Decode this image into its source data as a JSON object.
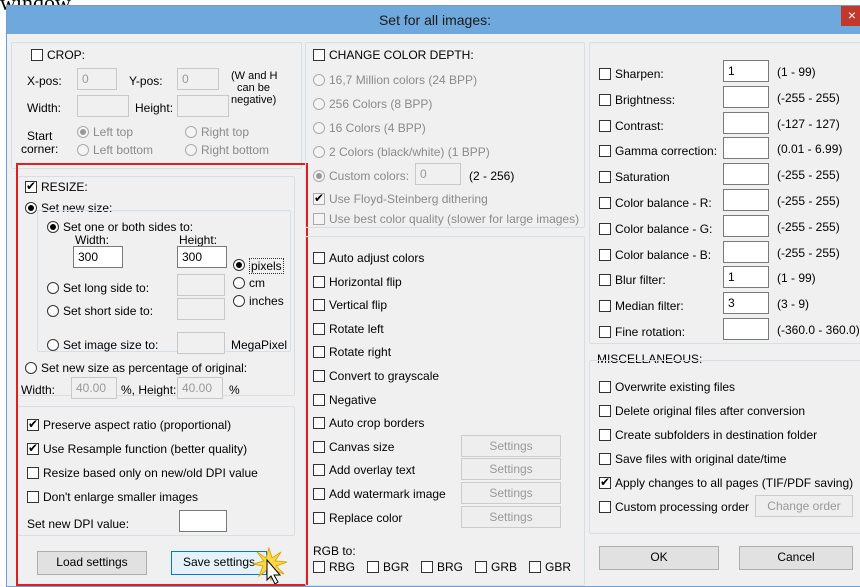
{
  "caption": "window.",
  "dialog": {
    "title": "Set for all images:",
    "close": "×"
  },
  "crop": {
    "label": "CROP:",
    "xpos_label": "X-pos:",
    "xpos": "0",
    "ypos_label": "Y-pos:",
    "ypos": "0",
    "note": [
      "(W and H",
      "can be",
      "negative)"
    ],
    "width_label": "Width:",
    "height_label": "Height:",
    "start_corner": [
      "Start",
      "corner:"
    ],
    "left_top": "Left top",
    "right_top": "Right top",
    "left_bottom": "Left bottom",
    "right_bottom": "Right bottom"
  },
  "resize": {
    "label": "RESIZE:",
    "set_new_size": "Set new size:",
    "set_one_or_both": "Set one or both sides to:",
    "width_label": "Width:",
    "height_label": "Height:",
    "width": "300",
    "height": "300",
    "units": [
      "pixels",
      "cm",
      "inches"
    ],
    "long_side": "Set long side to:",
    "short_side": "Set short side to:",
    "image_size": "Set image size to:",
    "megapixel": "MegaPixel",
    "percentage": "Set new size as percentage of original:",
    "pct_width_label": "Width:",
    "pct_width": "40.00",
    "pct_height_label": "%, Height:",
    "pct_height": "40.00",
    "pct_sign": "%"
  },
  "options": {
    "preserve_aspect": "Preserve aspect ratio (proportional)",
    "resample": "Use Resample function (better quality)",
    "dpi_based": "Resize based only on new/old DPI value",
    "dont_enlarge": "Don't enlarge smaller images",
    "set_dpi": "Set new DPI value:"
  },
  "buttons": {
    "load": "Load settings",
    "save": "Save settings",
    "ok": "OK",
    "cancel": "Cancel"
  },
  "color_depth": {
    "label": "CHANGE COLOR DEPTH:",
    "options": [
      "16,7 Million colors (24 BPP)",
      "256 Colors (8 BPP)",
      "16 Colors (4 BPP)",
      "2 Colors (black/white) (1 BPP)"
    ],
    "custom": "Custom colors:",
    "custom_value": "0",
    "custom_range": "(2 - 256)",
    "floyd": "Use Floyd-Steinberg dithering",
    "best_quality": "Use best color quality (slower for large images)"
  },
  "transforms": {
    "items": [
      "Auto adjust colors",
      "Horizontal flip",
      "Vertical flip",
      "Rotate left",
      "Rotate right",
      "Convert to grayscale",
      "Negative",
      "Auto crop borders",
      "Canvas size",
      "Add overlay text",
      "Add watermark image",
      "Replace color"
    ],
    "settings_label": "Settings",
    "rgb_to": "RGB to:",
    "rgb_options": [
      "RBG",
      "BGR",
      "BRG",
      "GRB",
      "GBR"
    ]
  },
  "filters": {
    "items": [
      {
        "label": "Sharpen:",
        "value": "1",
        "range": "(1  -  99)"
      },
      {
        "label": "Brightness:",
        "value": "",
        "range": "(-255  -  255)"
      },
      {
        "label": "Contrast:",
        "value": "",
        "range": "(-127  -  127)"
      },
      {
        "label": "Gamma correction:",
        "value": "",
        "range": "(0.01  -  6.99)"
      },
      {
        "label": "Saturation",
        "value": "",
        "range": "(-255  -  255)"
      },
      {
        "label": "Color balance - R:",
        "value": "",
        "range": "(-255  -  255)"
      },
      {
        "label": "Color balance - G:",
        "value": "",
        "range": "(-255  -  255)"
      },
      {
        "label": "Color balance - B:",
        "value": "",
        "range": "(-255  -  255)"
      },
      {
        "label": "Blur filter:",
        "value": "1",
        "range": "(1  -  99)"
      },
      {
        "label": "Median filter:",
        "value": "3",
        "range": "(3  -  9)"
      },
      {
        "label": "Fine rotation:",
        "value": "",
        "range": "(-360.0  -  360.0)"
      }
    ]
  },
  "misc": {
    "label": "MISCELLANEOUS:",
    "items": [
      "Overwrite existing files",
      "Delete original files after conversion",
      "Create subfolders in destination folder",
      "Save files with original date/time",
      "Apply changes to all pages (TIF/PDF saving)",
      "Custom processing order"
    ],
    "change_order": "Change order"
  }
}
